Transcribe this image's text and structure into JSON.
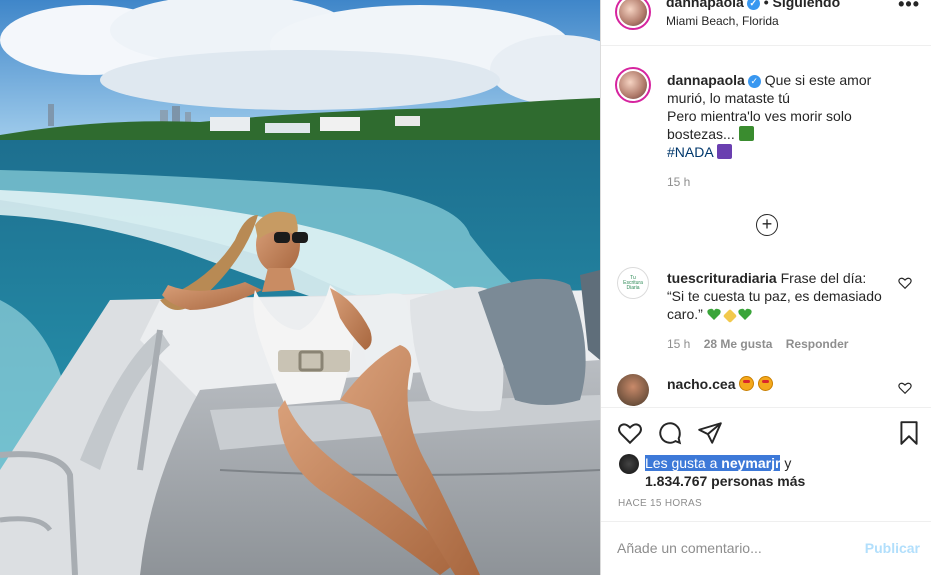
{
  "post": {
    "username": "dannapaola",
    "dot": "•",
    "follow_status": "Siguiendo",
    "location": "Miami Beach, Florida",
    "more_icon": "more-options-icon"
  },
  "caption": {
    "username": "dannapaola",
    "text_line1": "Que si este amor murió, lo mataste tú",
    "text_line2": "Pero mientra'lo ves morir solo bostezas...",
    "hashtag": "#NADA",
    "time": "15 h"
  },
  "comments": [
    {
      "username": "tuescrituradiaria",
      "text": "Frase del día: “Si te cuesta tu paz, es demasiado caro.”",
      "time": "15 h",
      "likes": "28 Me gusta",
      "reply": "Responder",
      "avatar_line1": "Tu",
      "avatar_line2": "Escritura",
      "avatar_line3": "Diaria"
    },
    {
      "username": "nacho.cea"
    }
  ],
  "likes": {
    "prefix": "Les gusta a",
    "user": "neymarjr",
    "suffix": "y",
    "others": "1.834.767 personas más"
  },
  "posted_ago": "HACE 15 HORAS",
  "comment_input": {
    "placeholder": "Añade un comentario...",
    "publish_label": "Publicar"
  },
  "colors": {
    "link_blue": "#00376b",
    "publish_disabled": "#b2dffc",
    "verified": "#3897f0",
    "selection": "#3d79d8"
  }
}
